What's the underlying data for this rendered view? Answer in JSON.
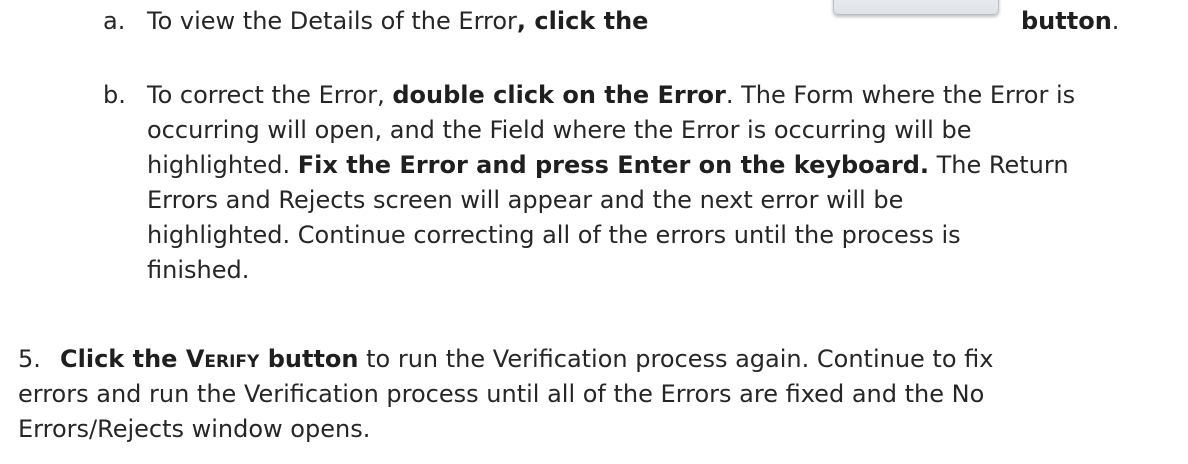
{
  "item_a": {
    "marker": "a.",
    "text_before": "To view the Details of the Error",
    "bold_text": ", click the",
    "button_label": "button",
    "trailing": "."
  },
  "item_b": {
    "marker": "b.",
    "line1_plain": "To correct the Error, ",
    "line1_bold": "double click on the Error",
    "line1_rest": ". The Form where the Error is",
    "line2": "occurring will open, and the Field where the Error is occurring will be",
    "line3_plain": "highlighted. ",
    "line3_bold": "Fix the Error and press Enter on the keyboard.",
    "line3_rest": " The Return",
    "line4": "Errors and Rejects screen will appear and the next error will be",
    "line5": "highlighted. Continue correcting all of the errors until the process is",
    "line6": "finished."
  },
  "item_5": {
    "marker": "5.",
    "bold_click": "Click the ",
    "bold_verify": "Verify",
    "bold_button": " button",
    "line1_rest": " to run the Verification process again. Continue to fix",
    "line2": "errors and run the Verification process until all of the Errors are fixed and the No",
    "line3": "Errors/Rejects window opens."
  }
}
